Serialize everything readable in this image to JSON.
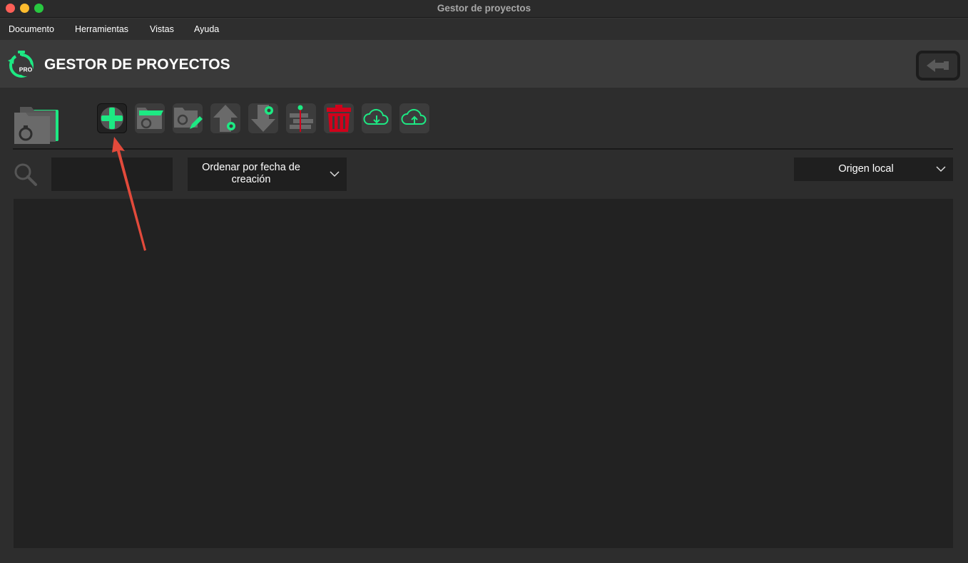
{
  "window": {
    "title": "Gestor de proyectos"
  },
  "menu": {
    "items": [
      "Documento",
      "Herramientas",
      "Vistas",
      "Ayuda"
    ]
  },
  "header": {
    "title": "GESTOR DE PROYECTOS",
    "logo_badge": "PRO"
  },
  "toolbar": {
    "buttons": [
      {
        "name": "new-project-icon",
        "selected": true
      },
      {
        "name": "open-project-icon"
      },
      {
        "name": "edit-project-icon"
      },
      {
        "name": "export-project-icon"
      },
      {
        "name": "import-project-icon"
      },
      {
        "name": "merge-project-icon"
      },
      {
        "name": "trash-icon"
      },
      {
        "name": "cloud-download-icon"
      },
      {
        "name": "cloud-upload-icon"
      }
    ]
  },
  "filters": {
    "search_value": "",
    "sort_selected": "Ordenar por fecha de creación",
    "origin_selected": "Origen local"
  },
  "colors": {
    "accent": "#1de983",
    "danger": "#d0021b",
    "annotation_arrow": "#e24a3b"
  }
}
